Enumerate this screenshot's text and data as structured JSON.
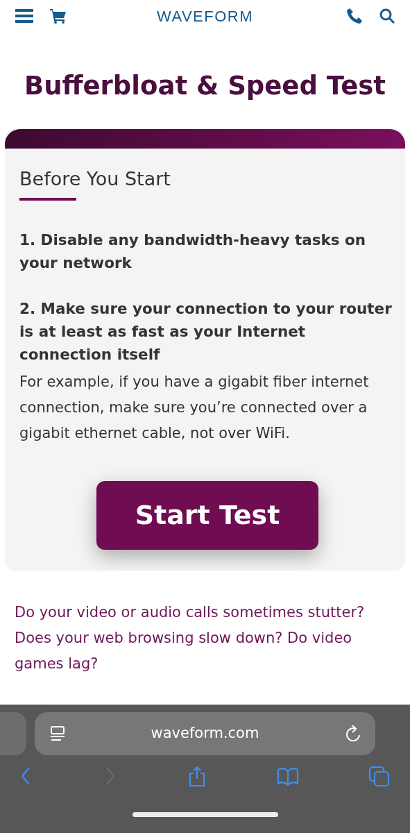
{
  "header": {
    "logo": "WAVEFORM"
  },
  "title": "Bufferbloat & Speed Test",
  "card": {
    "heading": "Before You Start",
    "steps": [
      {
        "kind": "step",
        "text": "1. Disable any bandwidth-heavy tasks on your network"
      },
      {
        "kind": "step",
        "text": "2. Make sure your connection to your router is at least as fast as your Internet connection itself"
      },
      {
        "kind": "note",
        "text": "For example, if you have a gigabit fiber internet connection, make sure you’re connected over a gigabit ethernet cable, not over WiFi."
      }
    ],
    "button": "Start Test"
  },
  "intro": "Do your video or audio calls sometimes stutter? Does your web browsing slow down? Do video games lag?",
  "browser": {
    "address": "waveform.com",
    "toolbar": [
      {
        "kind": "back",
        "disabled": false
      },
      {
        "kind": "forward",
        "disabled": true
      },
      {
        "kind": "share",
        "disabled": false
      },
      {
        "kind": "bookmarks",
        "disabled": false
      },
      {
        "kind": "tabs",
        "disabled": false
      }
    ]
  }
}
